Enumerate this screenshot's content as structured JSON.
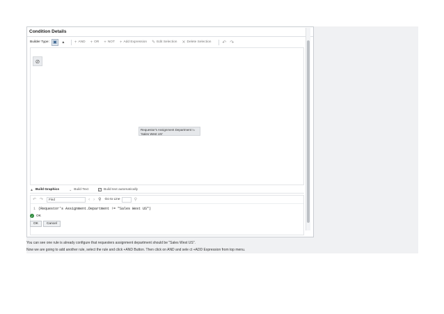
{
  "panel": {
    "title": "Condition Details"
  },
  "toolbar": {
    "builder_type_label": "Builder Type:",
    "items": {
      "and": "AND",
      "or": "OR",
      "not": "NOT",
      "add_expression": "Add Expression",
      "edit_selection": "Edit Selection",
      "delete_selection": "Delete Selection"
    },
    "icons": [
      "tree-view-icon",
      "graph-view-icon",
      "add-icon",
      "pencil-icon",
      "delete-icon",
      "undo-icon",
      "redo-icon"
    ]
  },
  "canvas": {
    "condition_node_text": "Requestor's Assignment Department != 'Sales West US'"
  },
  "bottom_tabs": {
    "build_graphics": "Build Graphics",
    "build_text": "Build Text",
    "build_text_automatically": "Build text automatically",
    "build_text_automatically_checked": true
  },
  "editor": {
    "find_value": "Find",
    "goto_line_label": "Go to Line",
    "line_number": "1",
    "code": "(Requestor's Assignment.Department != \"Sales West US\")"
  },
  "validation": {
    "status_text": "OK",
    "status_color": "#2e8b3d"
  },
  "buttons": {
    "ok": "OK",
    "cancel": "Cancel"
  },
  "captions": {
    "line1": "You can see one rule is already configure that requesters assignment department should be \"Sales West US\".",
    "line2": "Now we are going to add another rule, select the rule and click +AND Button. Then click on AND and sele ct +ADD Expression from top menu."
  }
}
